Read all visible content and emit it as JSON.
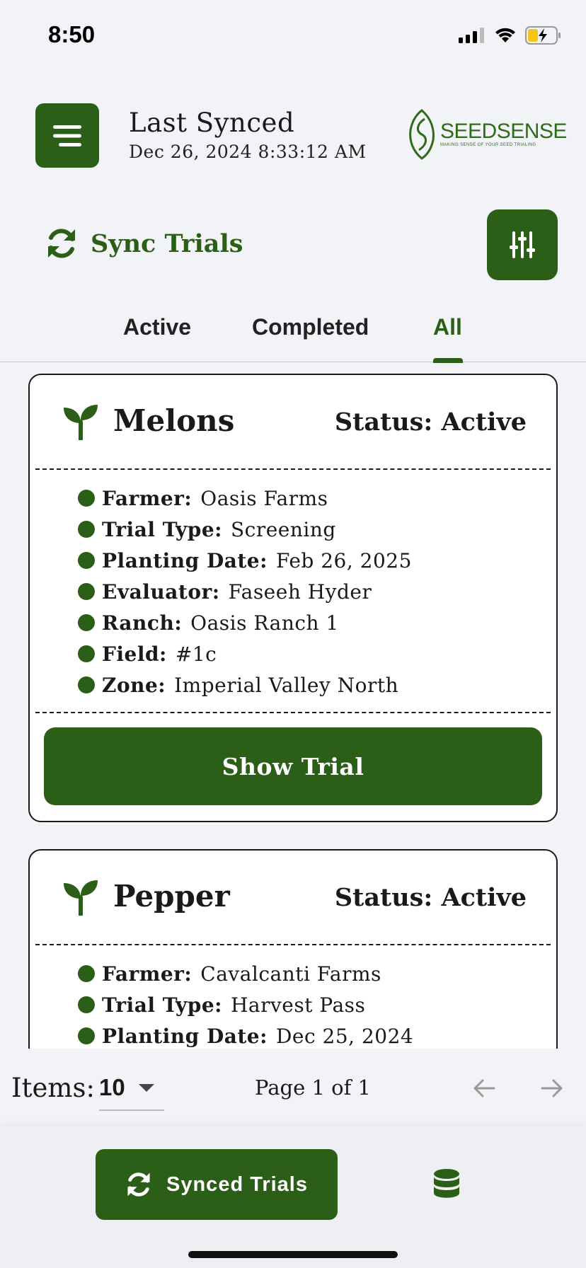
{
  "status_bar": {
    "time": "8:50"
  },
  "header": {
    "synced_title": "Last Synced",
    "synced_date": "Dec 26, 2024 8:33:12 AM",
    "logo_name": "SEEDSENSE",
    "logo_tagline": "MAKING SENSE OF YOUR SEED TRIALING"
  },
  "sync": {
    "label": "Sync Trials"
  },
  "tabs": [
    {
      "label": "Active"
    },
    {
      "label": "Completed"
    },
    {
      "label": "All"
    }
  ],
  "active_tab": "All",
  "cards": [
    {
      "crop": "Melons",
      "status": "Status: Active",
      "details": [
        {
          "label": "Farmer:",
          "value": "Oasis Farms"
        },
        {
          "label": "Trial Type:",
          "value": "Screening"
        },
        {
          "label": "Planting Date:",
          "value": "Feb 26, 2025"
        },
        {
          "label": "Evaluator:",
          "value": "Faseeh Hyder"
        },
        {
          "label": "Ranch:",
          "value": "Oasis Ranch 1"
        },
        {
          "label": "Field:",
          "value": "#1c"
        },
        {
          "label": "Zone:",
          "value": "Imperial Valley North"
        }
      ],
      "button": "Show Trial"
    },
    {
      "crop": "Pepper",
      "status": "Status: Active",
      "details": [
        {
          "label": "Farmer:",
          "value": "Cavalcanti Farms"
        },
        {
          "label": "Trial Type:",
          "value": "Harvest Pass"
        },
        {
          "label": "Planting Date:",
          "value": "Dec 25, 2024"
        }
      ]
    }
  ],
  "pagination": {
    "items_label": "Items:",
    "items_per_page": "10",
    "page_text": "Page 1 of 1"
  },
  "bottom_bar": {
    "synced_button": "Synced Trials"
  },
  "colors": {
    "brand_green": "#2b5e16",
    "background": "#f2f3f7"
  },
  "icons": [
    "menu-icon",
    "sync-icon",
    "filter-sliders-icon",
    "sprout-icon",
    "arrow-left-icon",
    "arrow-right-icon",
    "database-icon"
  ]
}
